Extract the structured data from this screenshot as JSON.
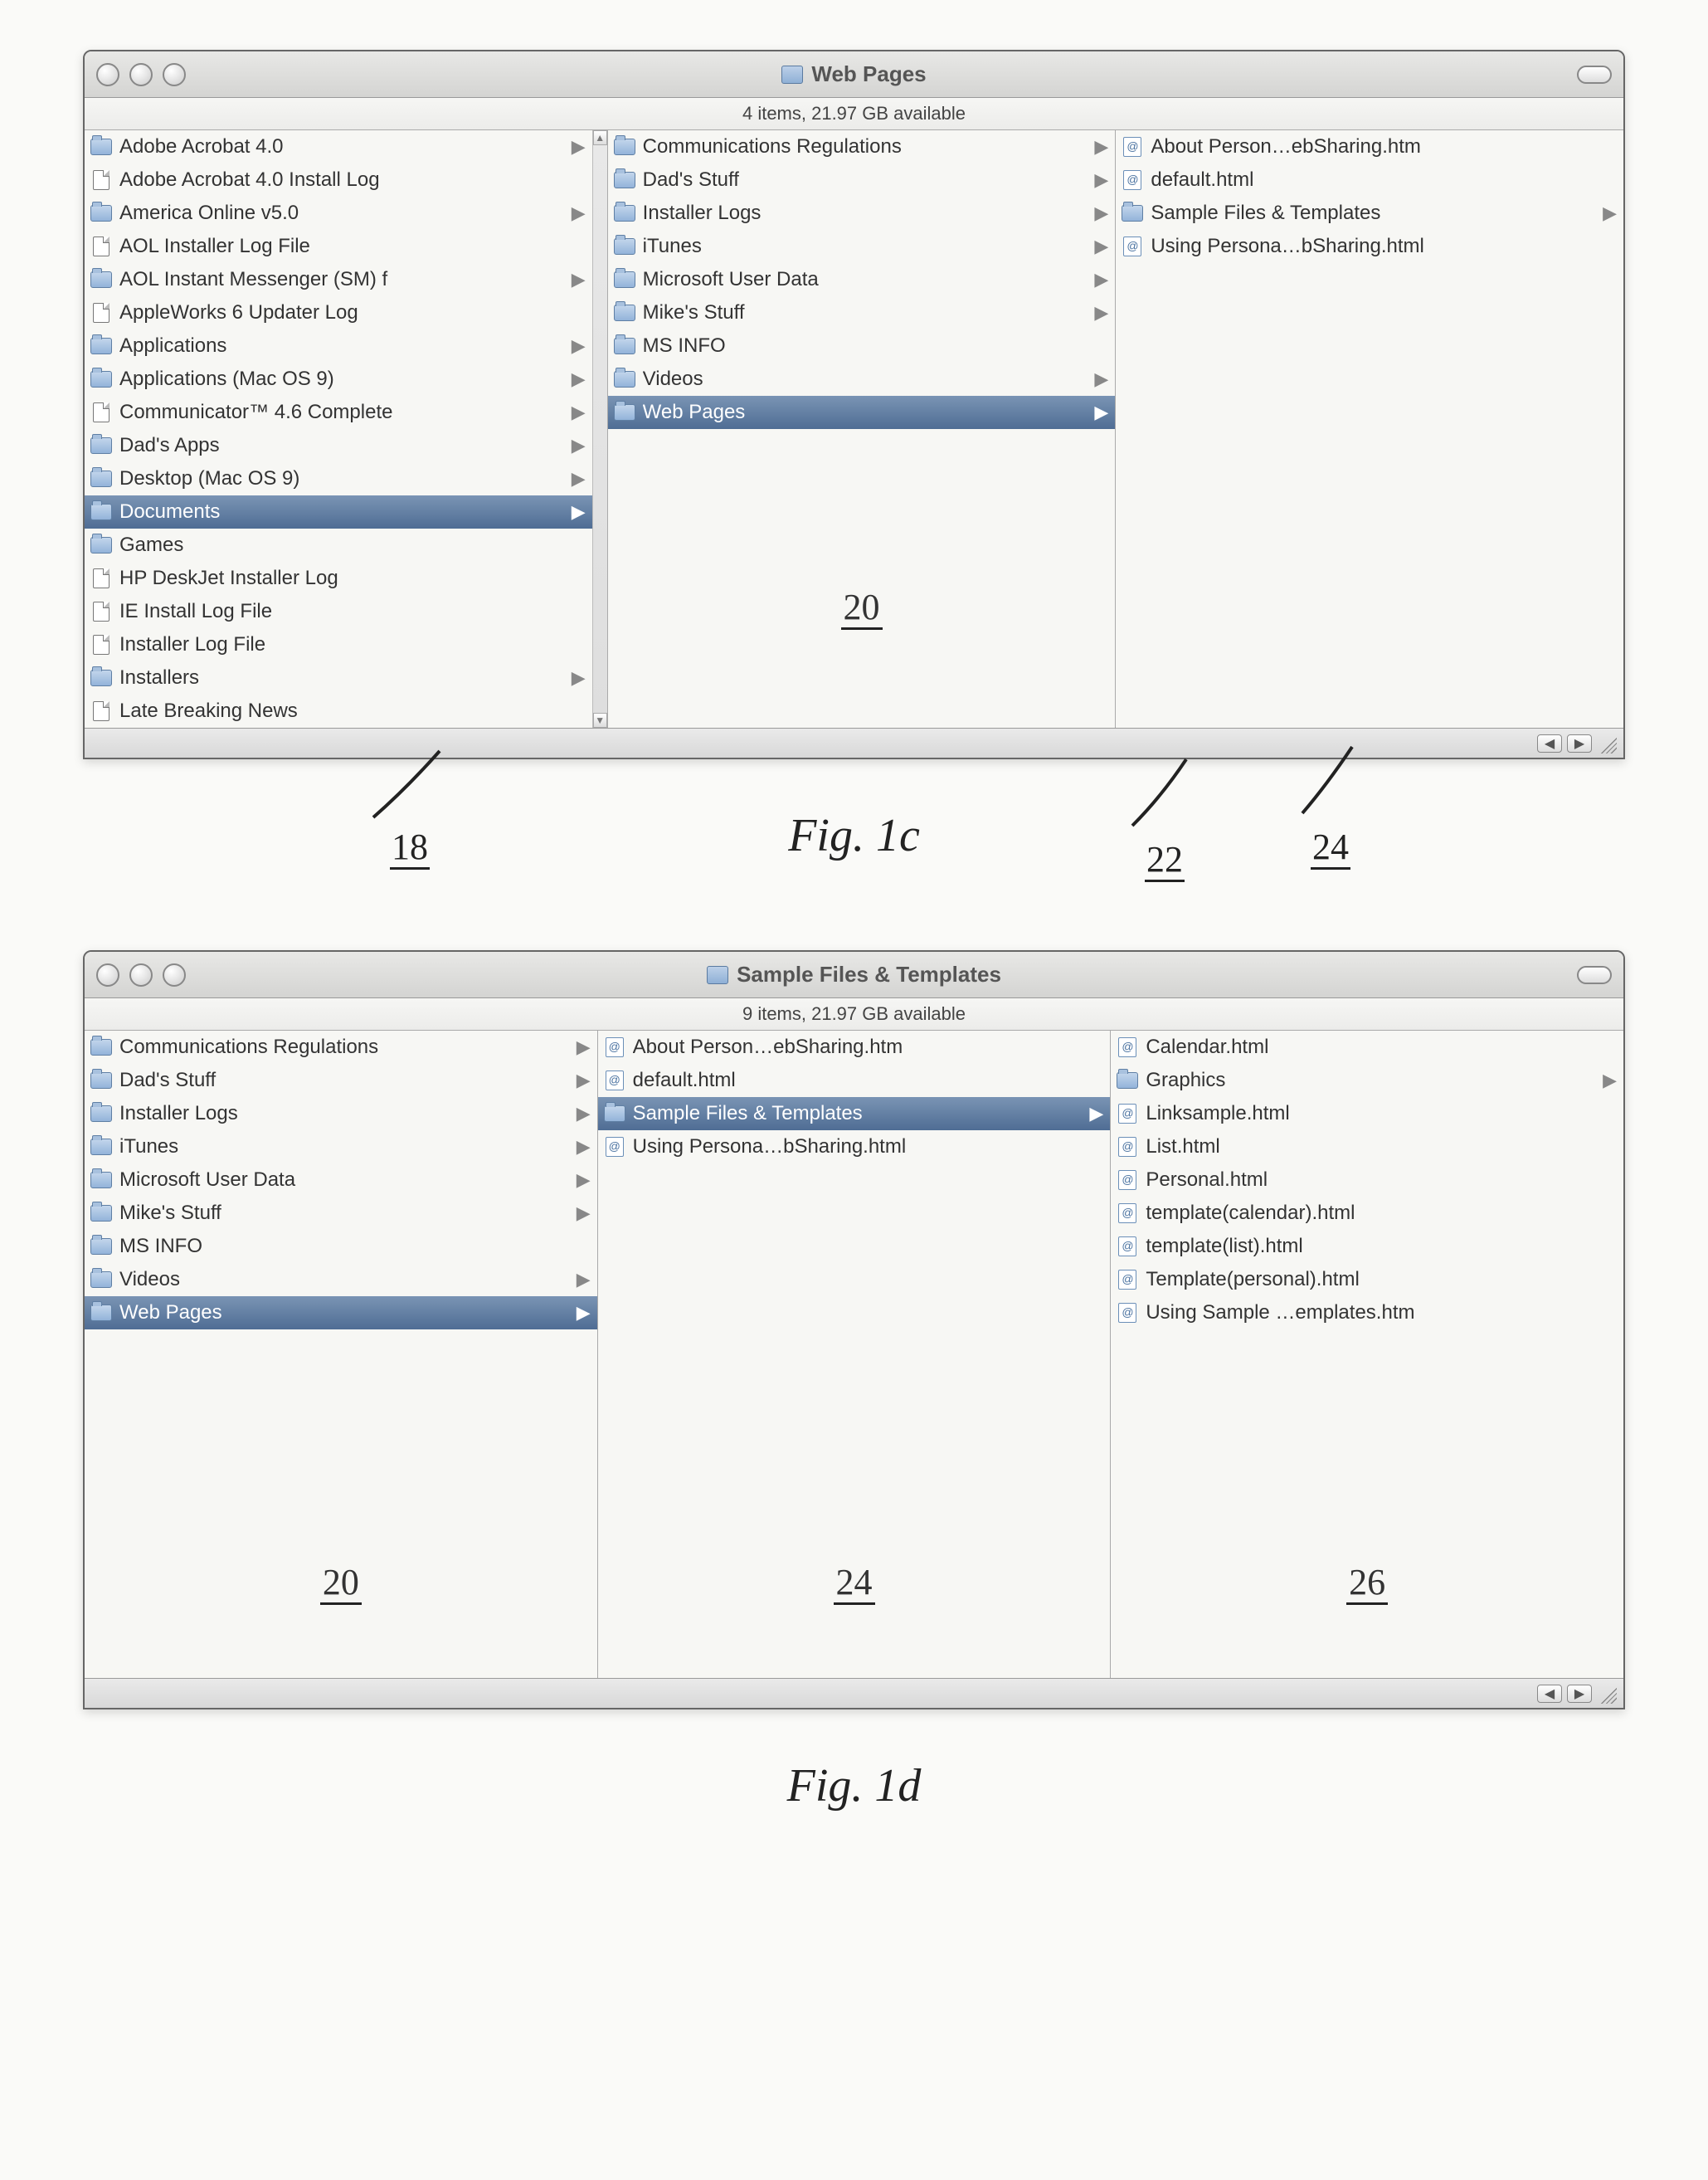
{
  "fig1c": {
    "title": "Web Pages",
    "status": "4 items, 21.97 GB available",
    "columns": [
      {
        "ref": "18",
        "selected_index": 11,
        "items": [
          {
            "label": "Adobe Acrobat 4.0",
            "icon": "folder",
            "expand": true
          },
          {
            "label": "Adobe Acrobat 4.0 Install Log",
            "icon": "doc",
            "expand": false
          },
          {
            "label": "America Online v5.0",
            "icon": "folder",
            "expand": true
          },
          {
            "label": "AOL Installer Log File",
            "icon": "doc",
            "expand": false
          },
          {
            "label": "AOL Instant Messenger (SM) f",
            "icon": "folder",
            "expand": true
          },
          {
            "label": "AppleWorks 6 Updater Log",
            "icon": "doc",
            "expand": false
          },
          {
            "label": "Applications",
            "icon": "folder",
            "expand": true
          },
          {
            "label": "Applications (Mac OS 9)",
            "icon": "folder",
            "expand": true
          },
          {
            "label": "Communicator™ 4.6 Complete",
            "icon": "doc",
            "expand": true
          },
          {
            "label": "Dad's Apps",
            "icon": "folder",
            "expand": true
          },
          {
            "label": "Desktop (Mac OS 9)",
            "icon": "folder",
            "expand": true
          },
          {
            "label": "Documents",
            "icon": "folder",
            "expand": true
          },
          {
            "label": "Games",
            "icon": "folder",
            "expand": false
          },
          {
            "label": "HP DeskJet Installer Log",
            "icon": "doc",
            "expand": false
          },
          {
            "label": "IE Install Log File",
            "icon": "doc",
            "expand": false
          },
          {
            "label": "Installer Log File",
            "icon": "doc",
            "expand": false
          },
          {
            "label": "Installers",
            "icon": "folder",
            "expand": true
          },
          {
            "label": "Late Breaking News",
            "icon": "doc",
            "expand": false
          }
        ]
      },
      {
        "ref": "20",
        "selected_index": 8,
        "items": [
          {
            "label": "Communications Regulations",
            "icon": "folder",
            "expand": true
          },
          {
            "label": "Dad's Stuff",
            "icon": "folder",
            "expand": true
          },
          {
            "label": "Installer Logs",
            "icon": "folder",
            "expand": true
          },
          {
            "label": "iTunes",
            "icon": "folder",
            "expand": true
          },
          {
            "label": "Microsoft User Data",
            "icon": "folder",
            "expand": true
          },
          {
            "label": "Mike's Stuff",
            "icon": "folder",
            "expand": true
          },
          {
            "label": "MS INFO",
            "icon": "folder",
            "expand": false
          },
          {
            "label": "Videos",
            "icon": "folder",
            "expand": true
          },
          {
            "label": "Web Pages",
            "icon": "folder",
            "expand": true
          }
        ]
      },
      {
        "ref": "22",
        "selected_index": -1,
        "items": [
          {
            "label": "About Person…ebSharing.htm",
            "icon": "html",
            "expand": false
          },
          {
            "label": "default.html",
            "icon": "html",
            "expand": false
          },
          {
            "label": "Sample Files & Templates",
            "icon": "folder",
            "expand": true
          },
          {
            "label": "Using Persona…bSharing.html",
            "icon": "html",
            "expand": false
          }
        ]
      }
    ],
    "caption": "Fig. 1c",
    "extra_ref": "24"
  },
  "fig1d": {
    "title": "Sample Files & Templates",
    "status": "9 items, 21.97 GB available",
    "columns": [
      {
        "ref": "20",
        "selected_index": 8,
        "items": [
          {
            "label": "Communications Regulations",
            "icon": "folder",
            "expand": true
          },
          {
            "label": "Dad's Stuff",
            "icon": "folder",
            "expand": true
          },
          {
            "label": "Installer Logs",
            "icon": "folder",
            "expand": true
          },
          {
            "label": "iTunes",
            "icon": "folder",
            "expand": true
          },
          {
            "label": "Microsoft User Data",
            "icon": "folder",
            "expand": true
          },
          {
            "label": "Mike's Stuff",
            "icon": "folder",
            "expand": true
          },
          {
            "label": "MS INFO",
            "icon": "folder",
            "expand": false
          },
          {
            "label": "Videos",
            "icon": "folder",
            "expand": true
          },
          {
            "label": "Web Pages",
            "icon": "folder",
            "expand": true
          }
        ]
      },
      {
        "ref": "24",
        "selected_index": 2,
        "items": [
          {
            "label": "About Person…ebSharing.htm",
            "icon": "html",
            "expand": false
          },
          {
            "label": "default.html",
            "icon": "html",
            "expand": false
          },
          {
            "label": "Sample Files & Templates",
            "icon": "folder",
            "expand": true
          },
          {
            "label": "Using Persona…bSharing.html",
            "icon": "html",
            "expand": false
          }
        ]
      },
      {
        "ref": "26",
        "selected_index": -1,
        "items": [
          {
            "label": "Calendar.html",
            "icon": "html",
            "expand": false
          },
          {
            "label": "Graphics",
            "icon": "folder",
            "expand": true
          },
          {
            "label": "Linksample.html",
            "icon": "html",
            "expand": false
          },
          {
            "label": "List.html",
            "icon": "html",
            "expand": false
          },
          {
            "label": "Personal.html",
            "icon": "html",
            "expand": false
          },
          {
            "label": "template(calendar).html",
            "icon": "html",
            "expand": false
          },
          {
            "label": "template(list).html",
            "icon": "html",
            "expand": false
          },
          {
            "label": "Template(personal).html",
            "icon": "html",
            "expand": false
          },
          {
            "label": "Using Sample …emplates.htm",
            "icon": "html",
            "expand": false
          }
        ]
      }
    ],
    "caption": "Fig. 1d"
  }
}
